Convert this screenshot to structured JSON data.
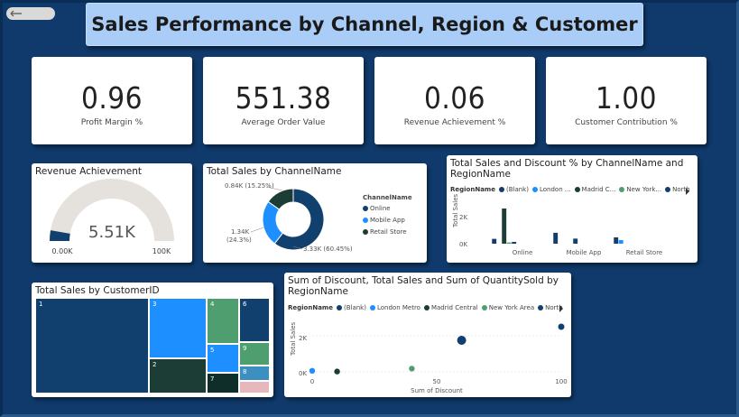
{
  "page": {
    "title": "Sales Performance by Channel, Region & Customer"
  },
  "colors": {
    "online": "#12406e",
    "mobile": "#1e8fff",
    "retail": "#1b3d36",
    "blank": "#143d6b",
    "london": "#1e8fff",
    "madrid": "#1b3d36",
    "newyork": "#4f9e6f",
    "north": "#12406e",
    "pink": "#e6b8bd"
  },
  "kpis": [
    {
      "value": "0.96",
      "label": "Profit Margin %"
    },
    {
      "value": "551.38",
      "label": "Average Order Value"
    },
    {
      "value": "0.06",
      "label": "Revenue Achievement %"
    },
    {
      "value": "1.00",
      "label": "Customer Contribution %"
    }
  ],
  "gauge": {
    "title": "Revenue Achievement",
    "value_label": "5.51K",
    "min_label": "0.00K",
    "max_label": "100K",
    "value": 5510,
    "min": 0,
    "max": 100000
  },
  "donut": {
    "title": "Total Sales by ChannelName",
    "legend_title": "ChannelName",
    "labels": [
      "0.84K (15.25%)",
      "1.34K",
      "(24.3%)",
      "3.33K (60.45%)"
    ],
    "legend": [
      "Online",
      "Mobile App",
      "Retail Store"
    ]
  },
  "bar": {
    "title_line1": "Total Sales and Discount % by ChannelName and",
    "title_line2": "RegionName",
    "legend_title": "RegionName",
    "legend": [
      "(Blank)",
      "London ...",
      "Madrid C...",
      "New York...",
      "North"
    ],
    "ylabel": "Total Sales",
    "yticks": [
      "2K",
      "0K"
    ],
    "categories": [
      "Online",
      "Mobile App",
      "Retail Store"
    ]
  },
  "treemap": {
    "title": "Total Sales by CustomerID",
    "labels": [
      "1",
      "3",
      "4",
      "6",
      "2",
      "5",
      "9",
      "8",
      "7"
    ]
  },
  "scatter": {
    "title_line1": "Sum of Discount, Total Sales and Sum of QuantitySold by",
    "title_line2": "RegionName",
    "legend_title": "RegionName",
    "legend": [
      "(Blank)",
      "London Metro",
      "Madrid Central",
      "New York Area",
      "North"
    ],
    "ylabel": "Total Sales",
    "xlabel": "Sum of Discount",
    "yticks": [
      "2K",
      "0K"
    ],
    "xticks": [
      "0",
      "50",
      "100"
    ]
  },
  "chart_data": [
    {
      "type": "pie",
      "title": "Total Sales by ChannelName",
      "categories": [
        "Online",
        "Mobile App",
        "Retail Store"
      ],
      "values": [
        3330,
        1340,
        840
      ],
      "percent": [
        60.45,
        24.3,
        15.25
      ]
    },
    {
      "type": "bar",
      "title": "Total Sales and Discount % by ChannelName and RegionName",
      "categories": [
        "Online",
        "Mobile App",
        "Retail Store"
      ],
      "ylabel": "Total Sales",
      "ylim": [
        0,
        3200
      ],
      "series": [
        {
          "name": "(Blank)",
          "values": [
            400,
            900,
            520
          ]
        },
        {
          "name": "London ...",
          "values": [
            0,
            0,
            300
          ]
        },
        {
          "name": "Madrid C...",
          "values": [
            2900,
            0,
            0
          ]
        },
        {
          "name": "New York...",
          "values": [
            100,
            0,
            0
          ]
        },
        {
          "name": "North",
          "values": [
            150,
            420,
            0
          ]
        }
      ]
    },
    {
      "type": "scatter",
      "title": "Sum of Discount, Total Sales and Sum of QuantitySold by RegionName",
      "xlabel": "Sum of Discount",
      "ylabel": "Total Sales",
      "xlim": [
        0,
        100
      ],
      "ylim": [
        0,
        3000
      ],
      "points": [
        {
          "region": "(Blank)",
          "x": 0,
          "y": 60
        },
        {
          "region": "Madrid Central",
          "x": 10,
          "y": 20
        },
        {
          "region": "New York Area",
          "x": 40,
          "y": 180
        },
        {
          "region": "North",
          "x": 60,
          "y": 1750
        },
        {
          "region": "North",
          "x": 100,
          "y": 2500
        }
      ]
    }
  ]
}
